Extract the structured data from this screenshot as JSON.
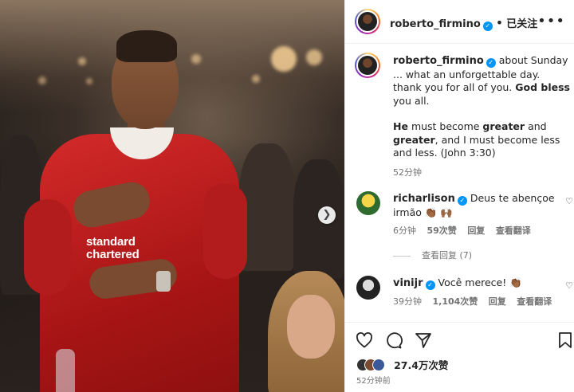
{
  "post": {
    "header": {
      "username": "roberto_firmino",
      "follow_label": "已关注",
      "more_icon": "more-horizontal-icon"
    },
    "caption": {
      "username": "roberto_firmino",
      "line1": "about Sunday ... what an unforgettable day. thank you for all of you.",
      "bold1": "God bless",
      "line1_end": "you all.",
      "verse_bold_start": "He",
      "verse_1": "must become",
      "verse_bold_greater1": "greater",
      "verse_2": "and",
      "verse_bold_greater2": "greater",
      "verse_3": ", and I must become less and less. (John 3:30)",
      "time": "52分钟"
    },
    "comments": [
      {
        "username": "richarlison",
        "text_line": "Deus te abençoe irmão",
        "emoji": "👏🏾 🙌🏾",
        "time": "6分钟",
        "likes": "59次赞",
        "reply": "回复",
        "translate": "查看翻译",
        "view_replies": "查看回复 (7)"
      },
      {
        "username": "vinijr",
        "text_line": "Você merece!",
        "emoji": "👏🏾",
        "time": "39分钟",
        "likes": "1,104次赞",
        "reply": "回复",
        "translate": "查看翻译"
      }
    ],
    "footer": {
      "likes_count": "27.4万次赞",
      "time_ago": "52分钟前"
    },
    "photo": {
      "sponsor_line1": "standard",
      "sponsor_line2": "chartered",
      "next_icon": "chevron-right-icon"
    }
  },
  "colors": {
    "accent": "#0095f6",
    "shirt_red": "#c8102e",
    "muted": "#737373"
  }
}
